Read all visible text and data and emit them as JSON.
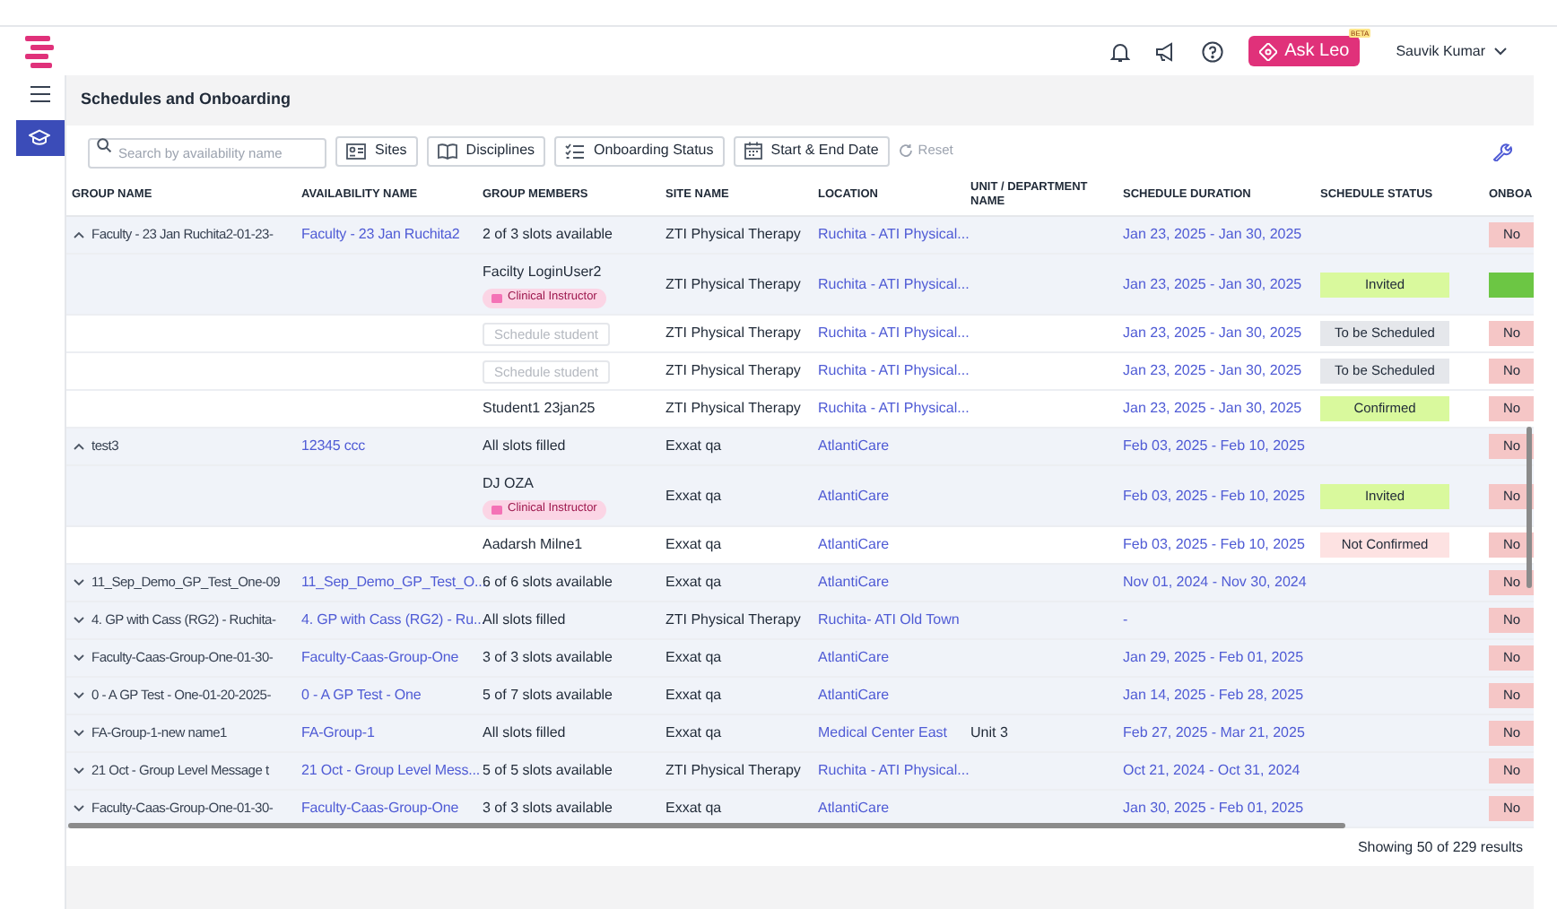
{
  "header": {
    "ask_button": "Ask Leo",
    "beta_badge": "BETA",
    "user_name": "Sauvik Kumar"
  },
  "sidebar": {
    "items": [
      {
        "kind": "schedules",
        "selected": true
      }
    ]
  },
  "page_title": "Schedules and Onboarding",
  "filters": {
    "search_placeholder": "Search by availability name",
    "buttons": [
      {
        "label": "Sites",
        "kind": "sites"
      },
      {
        "label": "Disciplines",
        "kind": "disciplines"
      },
      {
        "label": "Onboarding Status",
        "kind": "onboarding"
      },
      {
        "label": "Start & End Date",
        "kind": "dates"
      }
    ],
    "reset": {
      "label": "Reset",
      "disabled": true
    }
  },
  "table": {
    "columns": [
      "GROUP NAME",
      "AVAILABILITY NAME",
      "GROUP MEMBERS",
      "SITE NAME",
      "LOCATION",
      "UNIT / DEPARTMENT NAME",
      "SCHEDULE DURATION",
      "SCHEDULE STATUS",
      "ONBOA"
    ],
    "rows": [
      {
        "kind": "group",
        "expanded": true,
        "group_name": "Faculty - 23 Jan Ruchita2-01-23-",
        "availability_name": "Faculty - 23 Jan Ruchita2",
        "members": "2 of 3 slots available",
        "site": "ZTI Physical Therapy",
        "location": "Ruchita - ATI Physical...",
        "duration": "Jan 23, 2025 - Jan 30, 2025",
        "onboarding": {
          "text": "No",
          "kind": "no"
        }
      },
      {
        "kind": "member",
        "name": "Facilty LoginUser2",
        "role": "Clinical Instructor",
        "site": "ZTI Physical Therapy",
        "location": "Ruchita - ATI Physical...",
        "duration": "Jan 23, 2025 - Jan 30, 2025",
        "status": {
          "text": "Invited",
          "kind": "invited"
        },
        "onboarding": {
          "kind": "done"
        }
      },
      {
        "kind": "member",
        "action": "Schedule student",
        "site": "ZTI Physical Therapy",
        "location": "Ruchita - ATI Physical...",
        "duration": "Jan 23, 2025 - Jan 30, 2025",
        "status": {
          "text": "To be Scheduled",
          "kind": "pending"
        },
        "onboarding": {
          "text": "No",
          "kind": "no"
        }
      },
      {
        "kind": "member",
        "action": "Schedule student",
        "site": "ZTI Physical Therapy",
        "location": "Ruchita - ATI Physical...",
        "duration": "Jan 23, 2025 - Jan 30, 2025",
        "status": {
          "text": "To be Scheduled",
          "kind": "pending"
        },
        "onboarding": {
          "text": "No",
          "kind": "no"
        }
      },
      {
        "kind": "member",
        "name": "Student1 23jan25",
        "site": "ZTI Physical Therapy",
        "location": "Ruchita - ATI Physical...",
        "duration": "Jan 23, 2025 - Jan 30, 2025",
        "status": {
          "text": "Confirmed",
          "kind": "confirmed"
        },
        "onboarding": {
          "text": "No",
          "kind": "no"
        }
      },
      {
        "kind": "group",
        "expanded": true,
        "group_name": "test3",
        "availability_name": "12345 ccc",
        "members": "All slots filled",
        "site": "Exxat qa",
        "location": "AtlantiCare",
        "duration": "Feb 03, 2025 - Feb 10, 2025",
        "onboarding": {
          "text": "No",
          "kind": "no"
        }
      },
      {
        "kind": "member",
        "name": "DJ OZA",
        "role": "Clinical Instructor",
        "site": "Exxat qa",
        "location": "AtlantiCare",
        "duration": "Feb 03, 2025 - Feb 10, 2025",
        "status": {
          "text": "Invited",
          "kind": "invited"
        },
        "onboarding": {
          "text": "No",
          "kind": "no"
        }
      },
      {
        "kind": "member",
        "name": "Aadarsh Milne1",
        "site": "Exxat qa",
        "location": "AtlantiCare",
        "duration": "Feb 03, 2025 - Feb 10, 2025",
        "status": {
          "text": "Not Confirmed",
          "kind": "not_confirmed"
        },
        "onboarding": {
          "text": "No",
          "kind": "no"
        }
      },
      {
        "kind": "group",
        "expanded": false,
        "group_name": "11_Sep_Demo_GP_Test_One-09",
        "availability_name": "11_Sep_Demo_GP_Test_O...",
        "members": "6 of 6 slots available",
        "site": "Exxat qa",
        "location": "AtlantiCare",
        "duration": "Nov 01, 2024 - Nov 30, 2024",
        "onboarding": {
          "text": "No",
          "kind": "no"
        }
      },
      {
        "kind": "group",
        "expanded": false,
        "group_name": "4. GP with Cass (RG2) - Ruchita-",
        "availability_name": "4. GP with Cass (RG2) - Ru...",
        "members": "All slots filled",
        "site": "ZTI Physical Therapy",
        "location": "Ruchita- ATI Old Town",
        "duration": "-",
        "onboarding": {
          "text": "No",
          "kind": "no"
        }
      },
      {
        "kind": "group",
        "expanded": false,
        "group_name": "Faculty-Caas-Group-One-01-30-",
        "availability_name": "Faculty-Caas-Group-One",
        "members": "3 of 3 slots available",
        "site": "Exxat qa",
        "location": "AtlantiCare",
        "duration": "Jan 29, 2025 - Feb 01, 2025",
        "onboarding": {
          "text": "No",
          "kind": "no"
        }
      },
      {
        "kind": "group",
        "expanded": false,
        "group_name": "0 - A GP Test - One-01-20-2025-",
        "availability_name": "0 - A GP Test - One",
        "members": "5 of 7 slots available",
        "site": "Exxat qa",
        "location": "AtlantiCare",
        "duration": "Jan 14, 2025 - Feb 28, 2025",
        "onboarding": {
          "text": "No",
          "kind": "no"
        }
      },
      {
        "kind": "group",
        "expanded": false,
        "group_name": "FA-Group-1-new name1",
        "availability_name": "FA-Group-1",
        "members": "All slots filled",
        "site": "Exxat qa",
        "location": "Medical Center East",
        "unit": "Unit 3",
        "duration": "Feb 27, 2025 - Mar 21, 2025",
        "onboarding": {
          "text": "No",
          "kind": "no"
        }
      },
      {
        "kind": "group",
        "expanded": false,
        "group_name": "21 Oct - Group Level Message t",
        "availability_name": "21 Oct - Group Level Mess...",
        "members": "5 of 5 slots available",
        "site": "ZTI Physical Therapy",
        "location": "Ruchita - ATI Physical...",
        "duration": "Oct 21, 2024 - Oct 31, 2024",
        "onboarding": {
          "text": "No",
          "kind": "no"
        }
      },
      {
        "kind": "group",
        "expanded": false,
        "group_name": "Faculty-Caas-Group-One-01-30-",
        "availability_name": "Faculty-Caas-Group-One",
        "members": "3 of 3 slots available",
        "site": "Exxat qa",
        "location": "AtlantiCare",
        "duration": "Jan 30, 2025 - Feb 01, 2025",
        "onboarding": {
          "text": "No",
          "kind": "no"
        }
      }
    ]
  },
  "footer": "Showing 50 of 229 results"
}
